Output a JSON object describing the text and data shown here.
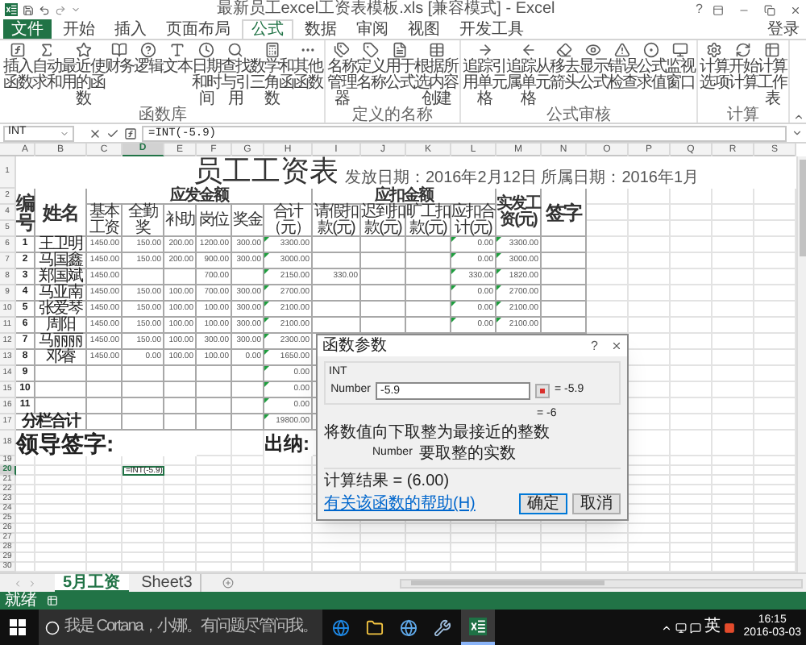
{
  "title_bar": {
    "title": "最新员工excel工资表模板.xls [兼容模式] - Excel",
    "help": "?"
  },
  "ribbon_tabs": [
    {
      "label": "文件",
      "kind": "file",
      "selected": false
    },
    {
      "label": "开始",
      "kind": "tab",
      "selected": false
    },
    {
      "label": "插入",
      "kind": "tab",
      "selected": false
    },
    {
      "label": "页面布局",
      "kind": "tab",
      "selected": false
    },
    {
      "label": "公式",
      "kind": "tab",
      "selected": true
    },
    {
      "label": "数据",
      "kind": "tab",
      "selected": false
    },
    {
      "label": "审阅",
      "kind": "tab",
      "selected": false
    },
    {
      "label": "视图",
      "kind": "tab",
      "selected": false
    },
    {
      "label": "开发工具",
      "kind": "tab",
      "selected": false
    }
  ],
  "sign_in": "登录",
  "ribbon_groups": [
    {
      "label": "函数库",
      "buttons": [
        "插入函数",
        "自动求和",
        "最近使用的函数",
        "财务",
        "逻辑",
        "文本",
        "日期和时间",
        "查找与引用",
        "数学和三角函数",
        "其他函数"
      ]
    },
    {
      "label": "定义的名称",
      "buttons": [
        "名称管理器",
        "定义名称",
        "用于公式",
        "根据所选内容创建"
      ]
    },
    {
      "label": "公式审核",
      "buttons": [
        "追踪引用单元格",
        "追踪从属单元格",
        "移去箭头",
        "显示公式",
        "错误检查",
        "公式求值",
        "监视窗口"
      ]
    },
    {
      "label": "计算",
      "buttons": [
        "计算选项",
        "开始计算",
        "计算工作表"
      ]
    }
  ],
  "formula_bar": {
    "name_box": "INT",
    "formula": "=INT(-5.9)"
  },
  "sheet": {
    "columns": [
      {
        "letter": "A",
        "selected": false,
        "error_flag": false
      },
      {
        "letter": "B",
        "selected": false,
        "error_flag": false
      },
      {
        "letter": "C",
        "selected": false,
        "error_flag": false
      },
      {
        "letter": "D",
        "selected": true,
        "error_flag": false
      },
      {
        "letter": "E",
        "selected": false,
        "error_flag": false
      },
      {
        "letter": "F",
        "selected": false,
        "error_flag": false
      },
      {
        "letter": "G",
        "selected": false,
        "error_flag": false
      },
      {
        "letter": "H",
        "selected": false,
        "error_flag": true
      },
      {
        "letter": "I",
        "selected": false,
        "error_flag": false
      },
      {
        "letter": "J",
        "selected": false,
        "error_flag": false
      },
      {
        "letter": "K",
        "selected": false,
        "error_flag": false
      },
      {
        "letter": "L",
        "selected": false,
        "error_flag": true
      },
      {
        "letter": "M",
        "selected": false,
        "error_flag": true
      },
      {
        "letter": "N",
        "selected": false,
        "error_flag": false
      },
      {
        "letter": "O",
        "selected": false,
        "error_flag": false
      },
      {
        "letter": "P",
        "selected": false,
        "error_flag": false
      },
      {
        "letter": "Q",
        "selected": false,
        "error_flag": false
      },
      {
        "letter": "R",
        "selected": false,
        "error_flag": false
      },
      {
        "letter": "S",
        "selected": false,
        "error_flag": false
      }
    ],
    "row_headers": [
      {
        "label": "1",
        "selected": false
      },
      {
        "label": "2",
        "selected": false
      },
      {
        "label": "4",
        "selected": false
      },
      {
        "label": "5",
        "selected": false
      },
      {
        "label": "6",
        "selected": false
      },
      {
        "label": "7",
        "selected": false
      },
      {
        "label": "8",
        "selected": false
      },
      {
        "label": "9",
        "selected": false
      },
      {
        "label": "10",
        "selected": false
      },
      {
        "label": "11",
        "selected": false
      },
      {
        "label": "12",
        "selected": false
      },
      {
        "label": "13",
        "selected": false
      },
      {
        "label": "14",
        "selected": false
      },
      {
        "label": "15",
        "selected": false
      },
      {
        "label": "16",
        "selected": false
      },
      {
        "label": "17",
        "selected": false
      },
      {
        "label": "18",
        "selected": false
      },
      {
        "label": "19",
        "selected": false
      },
      {
        "label": "20",
        "selected": true
      },
      {
        "label": "21",
        "selected": false
      },
      {
        "label": "22",
        "selected": false
      },
      {
        "label": "23",
        "selected": false
      },
      {
        "label": "24",
        "selected": false
      },
      {
        "label": "25",
        "selected": false
      },
      {
        "label": "26",
        "selected": false
      },
      {
        "label": "27",
        "selected": false
      },
      {
        "label": "28",
        "selected": false
      },
      {
        "label": "29",
        "selected": false
      },
      {
        "label": "30",
        "selected": false
      }
    ],
    "title": "员工工资表",
    "subtitle": "发放日期：2016年2月12日 所属日期：2016年1月",
    "header": {
      "id": "编号",
      "name": "姓名",
      "earnings_group": "应发金额",
      "earnings": [
        "基本工资",
        "全勤奖",
        "补助",
        "岗位",
        "奖金",
        "合计（元）"
      ],
      "deductions_group": "应扣金额",
      "deductions": [
        "请假扣款(元)",
        "迟到扣款(元)",
        "旷工扣款(元)",
        "应扣合计(元)"
      ],
      "net": "实发工资(元)",
      "signature": "签字"
    },
    "rows": [
      {
        "kind": "data",
        "cells": {
          "A": "1",
          "B": "王卫明",
          "C": "1450.00",
          "D": "150.00",
          "E": "200.00",
          "F": "1200.00",
          "G": "300.00",
          "H": "3300.00",
          "L": "0.00",
          "M": "3300.00"
        }
      },
      {
        "kind": "data",
        "cells": {
          "A": "2",
          "B": "马国鑫",
          "C": "1450.00",
          "D": "150.00",
          "E": "200.00",
          "F": "900.00",
          "G": "300.00",
          "H": "3000.00",
          "L": "0.00",
          "M": "3000.00"
        }
      },
      {
        "kind": "data",
        "cells": {
          "A": "3",
          "B": "郑国斌",
          "C": "1450.00",
          "F": "700.00",
          "H": "2150.00",
          "I": "330.00",
          "L": "330.00",
          "M": "1820.00"
        }
      },
      {
        "kind": "data",
        "cells": {
          "A": "4",
          "B": "马亚南",
          "C": "1450.00",
          "D": "150.00",
          "E": "100.00",
          "F": "700.00",
          "G": "300.00",
          "H": "2700.00",
          "L": "0.00",
          "M": "2700.00"
        }
      },
      {
        "kind": "data",
        "cells": {
          "A": "5",
          "B": "张爱琴",
          "C": "1450.00",
          "D": "150.00",
          "E": "100.00",
          "F": "100.00",
          "G": "300.00",
          "H": "2100.00",
          "L": "0.00",
          "M": "2100.00"
        }
      },
      {
        "kind": "data",
        "cells": {
          "A": "6",
          "B": "周阳",
          "C": "1450.00",
          "D": "150.00",
          "E": "100.00",
          "F": "100.00",
          "G": "300.00",
          "H": "2100.00",
          "L": "0.00",
          "M": "2100.00"
        }
      },
      {
        "kind": "data",
        "cells": {
          "A": "7",
          "B": "马丽丽",
          "C": "1450.00",
          "D": "150.00",
          "E": "100.00",
          "F": "300.00",
          "G": "300.00",
          "H": "2300.00"
        }
      },
      {
        "kind": "data",
        "cells": {
          "A": "8",
          "B": "邓睿",
          "C": "1450.00",
          "D": "0.00",
          "E": "100.00",
          "F": "100.00",
          "G": "0.00",
          "H": "1650.00"
        }
      },
      {
        "kind": "data",
        "cells": {
          "A": "9",
          "H": "0.00"
        }
      },
      {
        "kind": "data",
        "cells": {
          "A": "10",
          "H": "0.00"
        }
      },
      {
        "kind": "data",
        "cells": {
          "A": "11",
          "H": "0.00"
        }
      },
      {
        "kind": "total",
        "cells": {
          "A": "分栏合计",
          "H": "19800.00"
        }
      },
      {
        "kind": "signature",
        "cells": {
          "A": "领导签字:",
          "H": "出纳:"
        }
      }
    ],
    "active_cell": "=INT(-5.9)"
  },
  "dialog": {
    "title": "函数参数",
    "help": "?",
    "function": "INT",
    "argument": {
      "label": "Number",
      "value": "-5.9",
      "result": "= -5.9"
    },
    "result": "= -6",
    "description": "将数值向下取整为最接近的整数",
    "argument_help": {
      "label": "Number",
      "text": "要取整的实数"
    },
    "formula_result": "计算结果 = (6.00)",
    "help_link": "有关该函数的帮助(H)",
    "buttons": [
      {
        "label": "确定",
        "selected": true
      },
      {
        "label": "取消",
        "selected": false
      }
    ]
  },
  "sheet_tabs": [
    {
      "label": "5月工资",
      "selected": true
    },
    {
      "label": "Sheet3",
      "selected": false
    }
  ],
  "status_bar": {
    "status": "就绪"
  },
  "taskbar": {
    "search": "我是 Cortana，小娜。有问题尽管问我。",
    "ime": "英",
    "time": "16:15",
    "date": "2016-03-03"
  }
}
